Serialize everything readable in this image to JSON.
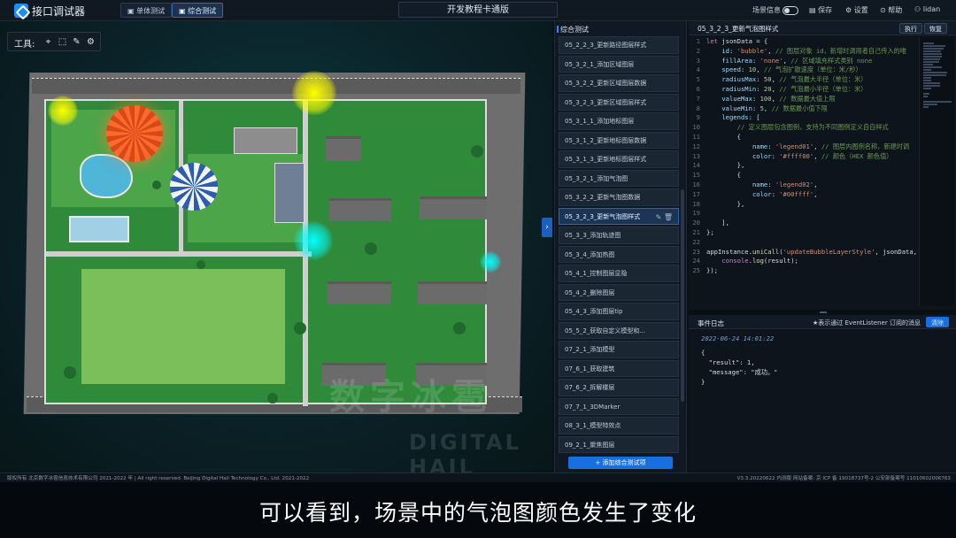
{
  "header": {
    "app_title": "接口调试器",
    "mode_single": "单体测试",
    "mode_combined": "综合测试",
    "center_title": "开发教程卡通版",
    "scene_info": "场景信息",
    "save": "保存",
    "settings": "设置",
    "help": "帮助",
    "user": "lidan"
  },
  "toolbar": {
    "label": "工具:"
  },
  "list": {
    "title": "综合测试",
    "items": [
      "05_2_2_3_更新路径图层样式",
      "05_3_2_1_添加区域图层",
      "05_3_2_2_更新区域图层数据",
      "05_3_2_3_更新区域图层样式",
      "05_3_1_1_添加地标图层",
      "05_3_1_2_更新地标图层数据",
      "05_3_1_3_更新地标图层样式",
      "05_3_2_1_添加气泡图",
      "05_3_2_2_更新气泡图数据",
      "05_3_2_3_更新气泡图样式",
      "05_3_3_添加轨迹图",
      "05_3_4_添加热图",
      "05_4_1_控制图层显隐",
      "05_4_2_删除图层",
      "05_4_3_添加图层tip",
      "05_5_2_获取自定义模型和...",
      "07_2_1_添加模型",
      "07_6_1_获取建筑",
      "07_6_2_拆解楼层",
      "07_7_1_3DMarker",
      "08_3_1_模型特效点",
      "09_2_1_聚焦图层"
    ],
    "active_index": 9,
    "add_label": "+ 添加综合测试项"
  },
  "code": {
    "title": "05_3_2_3_更新气泡图样式",
    "run": "执行",
    "restore": "恢复",
    "lines": [
      "let jsonData = {",
      "    id: 'bubble', // 图层对象 id，新增时调用者自己传入的唯",
      "    fillArea: 'none', // 区域填充样式类别 none",
      "    speed: 10, // 气泡扩散速度（单位：米/秒）",
      "    radiusMax: 50, // 气泡最大半径（单位：米）",
      "    radiusMin: 20, // 气泡最小半径（单位：米）",
      "    valueMax: 100, // 数据最大值上限",
      "    valueMin: 5, // 数据最小值下限",
      "    legends: [",
      "        // 定义图层包含图例，支持为不同图例定义自自样式",
      "        {",
      "            name: 'legend01', // 图层内图例名称，新建时调",
      "            color: '#ffff00', // 颜色（HEX 颜色值）",
      "        },",
      "        {",
      "            name: 'legend02',",
      "            color: '#00ffff',",
      "        },",
      "",
      "    ],",
      "};",
      "",
      "appInstance.uniCall('updateBubbleLayerStyle', jsonData,",
      "    console.log(result);",
      "});"
    ]
  },
  "log": {
    "title": "事件日志",
    "note": "★表示通过 EventListener 订阅的消息",
    "clear": "清除",
    "timestamp": "2022-06-24 14:01:22",
    "lines": [
      "{",
      "  \"result\": 1,",
      "  \"message\": \"成功。\"",
      "}"
    ]
  },
  "footer": {
    "left": "版权所有 北京数字冰雹信息技术有限公司 2021-2022 年 | All right reserved. Beijing Digital Hail Technology Co., Ltd. 2021-2022",
    "right": "V3.3.20220622 内测版  网站备案: 京 ICP 备 19018737号-2 公安部备案号 11010602006763"
  },
  "watermark": {
    "cn": "数字冰雹",
    "en": "DIGITAL HAIL"
  },
  "caption": "可以看到，场景中的气泡图颜色发生了变化",
  "colors": {
    "accent": "#1a6fe0",
    "bubble_yellow": "#ffff00",
    "bubble_cyan": "#00ffff"
  }
}
